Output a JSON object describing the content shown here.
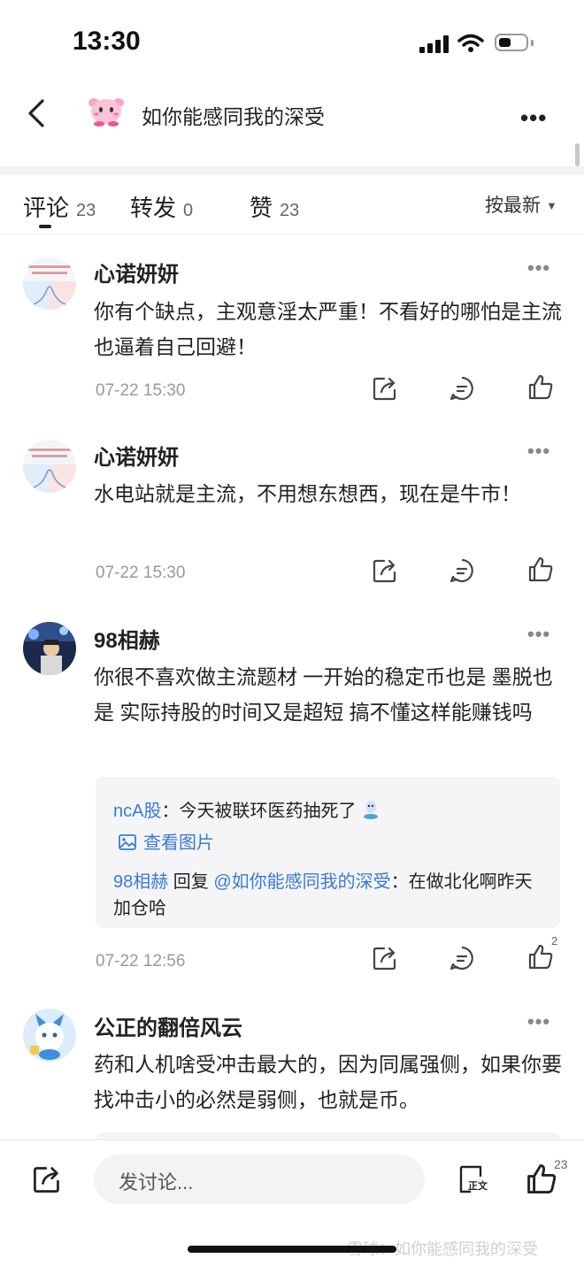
{
  "status_bar": {
    "time": "13:30"
  },
  "header": {
    "title": "如你能感同我的深受"
  },
  "tabs": [
    {
      "label": "评论",
      "count": "23"
    },
    {
      "label": "转发",
      "count": "0"
    },
    {
      "label": "赞",
      "count": "23"
    }
  ],
  "sort_label": "按最新",
  "comments": [
    {
      "name": "心诺妍妍",
      "text": "你有个缺点，主观意淫太严重！不看好的哪怕是主流也逼着自己回避！",
      "time": "07-22 15:30"
    },
    {
      "name": "心诺妍妍",
      "text": "水电站就是主流，不用想东想西，现在是牛市！",
      "time": "07-22 15:30"
    },
    {
      "name": "98相赫",
      "text": "你很不喜欢做主流题材 一开始的稳定币也是 墨脱也是 实际持股的时间又是超短 搞不懂这样能赚钱吗",
      "time": "07-22 12:56",
      "like_count": "2",
      "replies": {
        "first_user": "ncA股",
        "first_text": "：今天被联环医药抽死了",
        "view_image": "查看图片",
        "second_user": "98相赫",
        "second_verb": " 回复 ",
        "second_target": "@如你能感同我的深受",
        "second_text": "：在做北化啊昨天加仓哈"
      }
    },
    {
      "name": "公正的翻倍风云",
      "text": "药和人机啥受冲击最大的，因为同属强侧，如果你要找冲击小的必然是弱侧，也就是币。"
    }
  ],
  "bottom_bar": {
    "placeholder": "发讨论...",
    "like_count": "23",
    "body_label": "正文"
  },
  "watermark": "雪球：如你能感同我的深受",
  "colors": {
    "link": "#3a7ad4",
    "text": "#222222",
    "muted": "#999999"
  }
}
